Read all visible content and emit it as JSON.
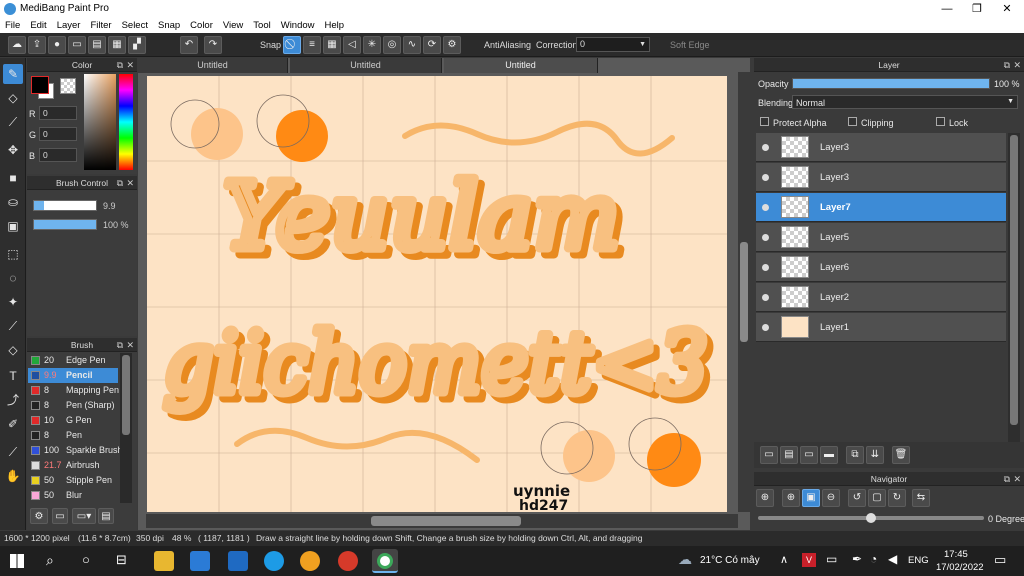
{
  "app": {
    "title": "MediBang Paint Pro"
  },
  "window_controls": {
    "minimize": "—",
    "maximize": "❐",
    "close": "✕"
  },
  "menu": [
    "File",
    "Edit",
    "Layer",
    "Filter",
    "Select",
    "Snap",
    "Color",
    "View",
    "Tool",
    "Window",
    "Help"
  ],
  "toolbar": {
    "snap_label": "Snap",
    "antialiasing_label": "AntiAliasing",
    "antialiasing_checked": true,
    "correction_label": "Correction",
    "correction_value": "0",
    "softedge_label": "Soft Edge",
    "softedge_checked": false
  },
  "color_panel": {
    "title": "Color",
    "r_label": "R",
    "r_value": "0",
    "g_label": "G",
    "g_value": "0",
    "b_label": "B",
    "b_value": "0",
    "primary": "#000000",
    "secondary": "#ffffff"
  },
  "brush_control": {
    "title": "Brush Control",
    "size": "9.9",
    "opacity": "100 %"
  },
  "brush_panel": {
    "title": "Brush",
    "items": [
      {
        "size": "20",
        "name": "Edge Pen",
        "color": "#22a83a"
      },
      {
        "size": "9.9",
        "name": "Pencil",
        "color": "#1f4fa0",
        "selected": true
      },
      {
        "size": "8",
        "name": "Mapping Pen",
        "color": "#e02a2a"
      },
      {
        "size": "8",
        "name": "Pen (Sharp)",
        "color": "#222222"
      },
      {
        "size": "10",
        "name": "G Pen",
        "color": "#e02a2a"
      },
      {
        "size": "8",
        "name": "Pen",
        "color": "#222222"
      },
      {
        "size": "100",
        "name": "Sparkle Brush",
        "color": "#3050d8"
      },
      {
        "size": "21.7",
        "name": "Airbrush",
        "color": "#dddddd"
      },
      {
        "size": "50",
        "name": "Stipple Pen",
        "color": "#e8d020"
      },
      {
        "size": "50",
        "name": "Blur",
        "color": "#f8a8d8"
      }
    ]
  },
  "tabs": [
    "Untitled",
    "Untitled",
    "Untitled"
  ],
  "canvas": {
    "line1": "Yeuulam",
    "line2": "giichomett<3",
    "signature_line1": "uynnie",
    "signature_line2": "hd247",
    "paper_color": "#fde3c5",
    "ink_color": "#f5a74a",
    "accent_orange": "#ff8a14"
  },
  "layer_panel": {
    "title": "Layer",
    "opacity_label": "Opacity",
    "opacity_value": "100 %",
    "opacity_percent": 100,
    "blending_label": "Blending",
    "blending_value": "Normal",
    "protect_alpha": "Protect Alpha",
    "clipping": "Clipping",
    "lock": "Lock",
    "layers": [
      {
        "name": "Layer3"
      },
      {
        "name": "Layer3"
      },
      {
        "name": "Layer7",
        "selected": true
      },
      {
        "name": "Layer5"
      },
      {
        "name": "Layer6"
      },
      {
        "name": "Layer2"
      },
      {
        "name": "Layer1",
        "fill": "#fde3c5"
      }
    ]
  },
  "navigator": {
    "title": "Navigator",
    "rotation": "0 Degree"
  },
  "status": {
    "dimensions": "1600 * 1200 pixel",
    "physical": "(11.6 * 8.7cm)",
    "dpi": "350 dpi",
    "zoom": "48 %",
    "coords": "( 1187, 1181 )",
    "hint": "Draw a straight line by holding down Shift, Change a brush size by holding down Ctrl, Alt, and dragging"
  },
  "taskbar": {
    "weather": "21°C Có mây",
    "lang": "ENG",
    "time": "17:45",
    "date": "17/02/2022"
  }
}
